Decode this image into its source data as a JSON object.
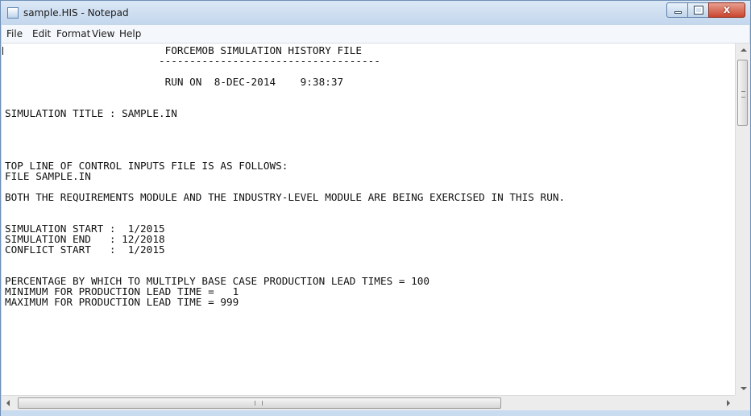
{
  "window": {
    "title": "sample.HIS - Notepad",
    "controls": {
      "minimize": "",
      "maximize": "",
      "close": "x"
    }
  },
  "menu": {
    "items": [
      "File",
      "Edit",
      "Format",
      "View",
      "Help"
    ]
  },
  "document": {
    "text": "                          FORCEMOB SIMULATION HISTORY FILE\n                         ------------------------------------\n\n                          RUN ON  8-DEC-2014    9:38:37\n\n\nSIMULATION TITLE : SAMPLE.IN\n\n\n\n\nTOP LINE OF CONTROL INPUTS FILE IS AS FOLLOWS:\nFILE SAMPLE.IN\n\nBOTH THE REQUIREMENTS MODULE AND THE INDUSTRY-LEVEL MODULE ARE BEING EXERCISED IN THIS RUN.\n\n\nSIMULATION START :  1/2015\nSIMULATION END   : 12/2018\nCONFLICT START   :  1/2015\n\n\nPERCENTAGE BY WHICH TO MULTIPLY BASE CASE PRODUCTION LEAD TIMES = 100\nMINIMUM FOR PRODUCTION LEAD TIME =   1\nMAXIMUM FOR PRODUCTION LEAD TIME = 999"
  },
  "scrollbars": {
    "horizontal_grip": "III"
  }
}
